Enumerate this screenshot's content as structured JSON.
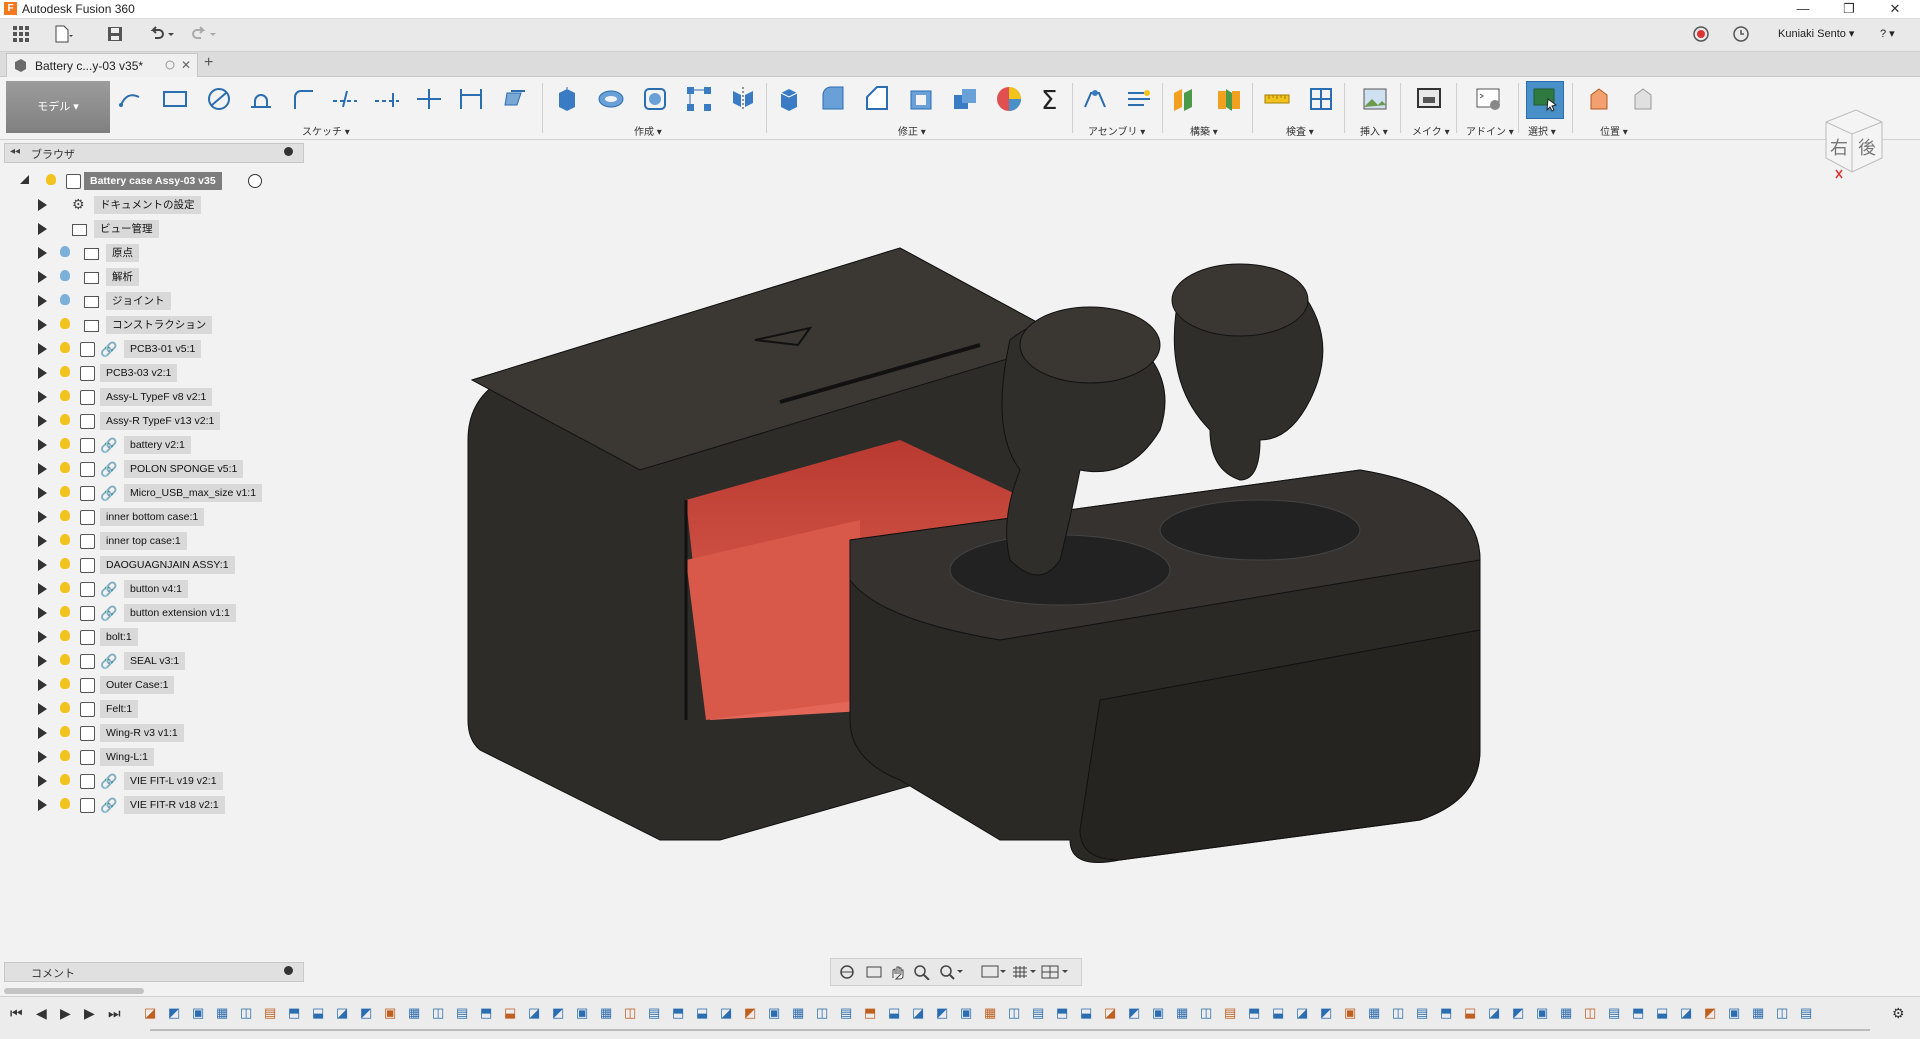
{
  "app": {
    "title": "Autodesk Fusion 360"
  },
  "window_controls": {
    "minimize": "—",
    "maximize": "❐",
    "close": "✕"
  },
  "quick_access": {
    "user": "Kuniaki Sento ▾",
    "help": "? ▾"
  },
  "document_tab": {
    "label": "Battery c...y-03 v35*",
    "close": "✕",
    "add": "+"
  },
  "ribbon": {
    "mode": "モデル ▾",
    "groups": [
      {
        "label": "スケッチ ▾"
      },
      {
        "label": "作成 ▾"
      },
      {
        "label": "修正 ▾"
      },
      {
        "label": "アセンブリ ▾"
      },
      {
        "label": "構築 ▾"
      },
      {
        "label": "検査 ▾"
      },
      {
        "label": "挿入 ▾"
      },
      {
        "label": "メイク ▾"
      },
      {
        "label": "アドイン ▾"
      },
      {
        "label": "選択 ▾"
      },
      {
        "label": "位置 ▾"
      }
    ]
  },
  "browser": {
    "header": "ブラウザ",
    "root": "Battery case Assy-03 v35",
    "items": [
      {
        "label": "ドキュメントの設定",
        "icon": "gear-icon"
      },
      {
        "label": "ビュー管理",
        "icon": "folder-icon"
      },
      {
        "label": "原点",
        "icon": "folder-icon"
      },
      {
        "label": "解析",
        "icon": "folder-icon"
      },
      {
        "label": "ジョイント",
        "icon": "folder-icon"
      },
      {
        "label": "コンストラクション",
        "icon": "folder-icon"
      },
      {
        "label": "PCB3-01 v5:1",
        "icon": "component-icon"
      },
      {
        "label": "PCB3-03 v2:1",
        "icon": "component-icon"
      },
      {
        "label": "Assy-L TypeF v8 v2:1",
        "icon": "component-icon"
      },
      {
        "label": "Assy-R TypeF v13 v2:1",
        "icon": "component-icon"
      },
      {
        "label": "battery v2:1",
        "icon": "component-icon"
      },
      {
        "label": "POLON SPONGE v5:1",
        "icon": "component-icon"
      },
      {
        "label": "Micro_USB_max_size v1:1",
        "icon": "component-icon"
      },
      {
        "label": "inner bottom case:1",
        "icon": "component-icon"
      },
      {
        "label": "inner top case:1",
        "icon": "component-icon"
      },
      {
        "label": "DAOGUAGNJAIN ASSY:1",
        "icon": "component-icon"
      },
      {
        "label": "button v4:1",
        "icon": "component-icon"
      },
      {
        "label": "button extension v1:1",
        "icon": "component-icon"
      },
      {
        "label": "bolt:1",
        "icon": "component-icon"
      },
      {
        "label": "SEAL v3:1",
        "icon": "component-icon"
      },
      {
        "label": "Outer Case:1",
        "icon": "component-icon"
      },
      {
        "label": "Felt:1",
        "icon": "component-icon"
      },
      {
        "label": "Wing-R v3 v1:1",
        "icon": "component-icon"
      },
      {
        "label": "Wing-L:1",
        "icon": "component-icon"
      },
      {
        "label": "VIE FIT-L v19 v2:1",
        "icon": "component-icon"
      },
      {
        "label": "VIE FIT-R v18 v2:1",
        "icon": "component-icon"
      }
    ]
  },
  "viewcube": {
    "face_right": "右",
    "face_back": "後"
  },
  "comment": {
    "label": "コメント"
  },
  "colors": {
    "accent": "#4a90c8",
    "case_dark": "#2e2c29",
    "case_red": "#d8584a",
    "bulb_yellow": "#f2c21d",
    "bulb_blue": "#7bb0d8"
  }
}
